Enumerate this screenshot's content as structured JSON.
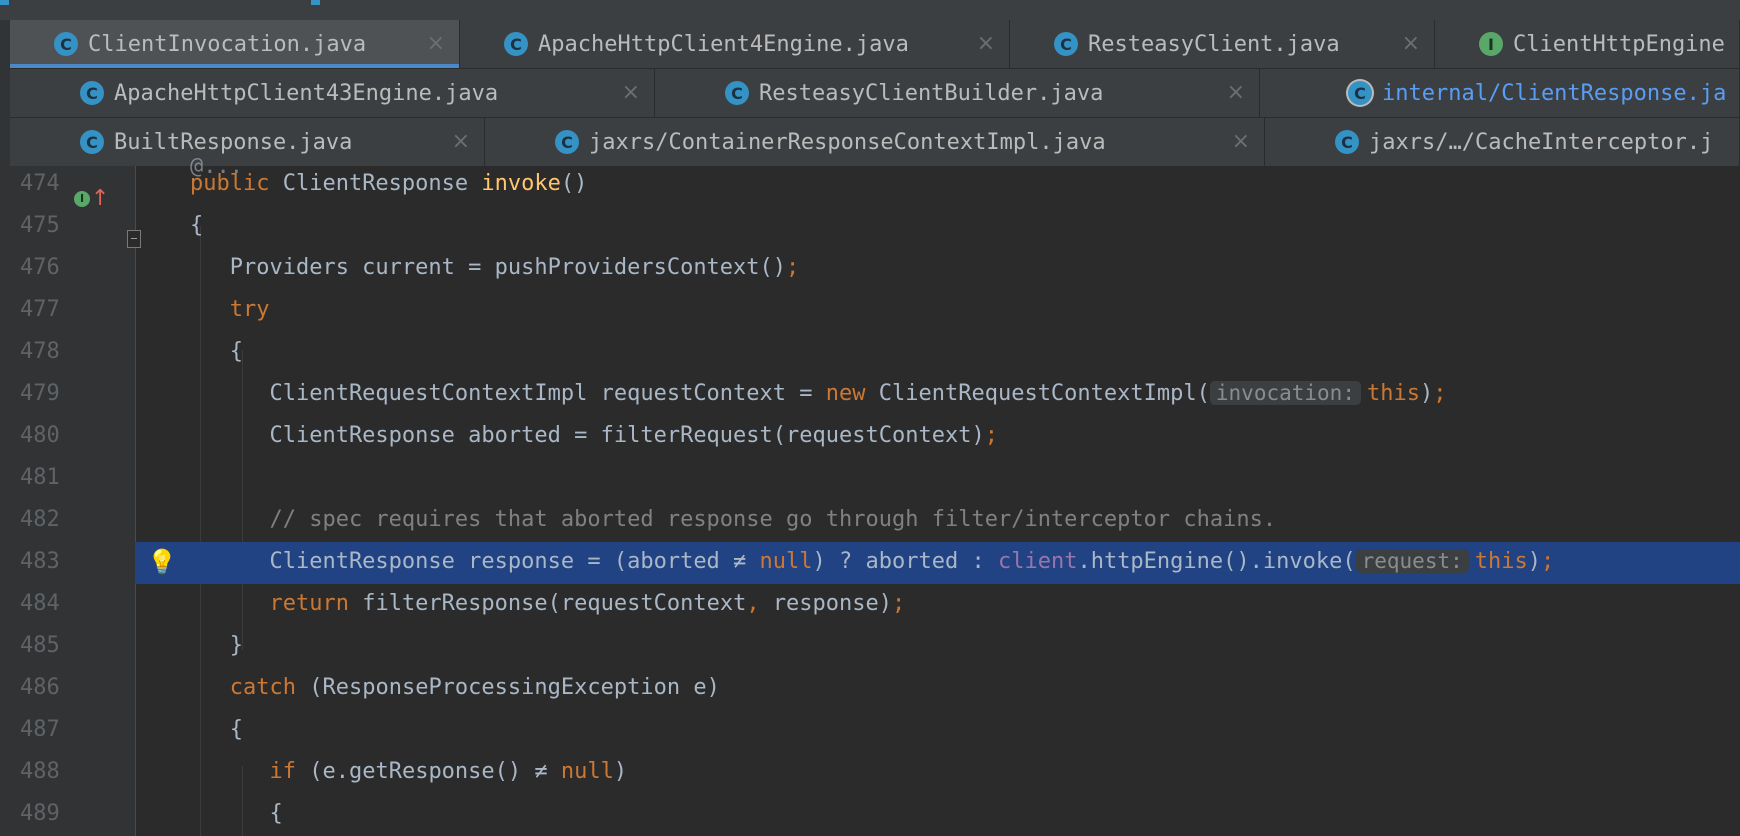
{
  "tab_rows": [
    [
      {
        "label": "ClientInvocation.java",
        "icon": "C",
        "icon_name": "class-icon",
        "active": true,
        "close": "×"
      },
      {
        "label": "ApacheHttpClient4Engine.java",
        "icon": "C",
        "icon_name": "class-icon",
        "close": "×"
      },
      {
        "label": "ResteasyClient.java",
        "icon": "C",
        "icon_name": "class-icon",
        "close": "×"
      },
      {
        "label": "ClientHttpEngine",
        "icon": "I",
        "icon_name": "interface-icon",
        "close": ""
      }
    ],
    [
      {
        "label": "ApacheHttpClient43Engine.java",
        "icon": "C",
        "icon_name": "class-icon",
        "close": "×"
      },
      {
        "label": "ResteasyClientBuilder.java",
        "icon": "C",
        "icon_name": "class-icon",
        "close": "×"
      },
      {
        "label": "internal/ClientResponse.ja",
        "icon": "C",
        "icon_name": "class-icon",
        "close": ""
      }
    ],
    [
      {
        "label": "BuiltResponse.java",
        "icon": "C",
        "icon_name": "class-icon",
        "close": "×"
      },
      {
        "label": "jaxrs/ContainerResponseContextImpl.java",
        "icon": "C",
        "icon_name": "class-icon",
        "close": "×"
      },
      {
        "label": "jaxrs/…/CacheInterceptor.j",
        "icon": "C",
        "icon_name": "class-icon",
        "close": ""
      }
    ]
  ],
  "editor": {
    "top_fragment": "@...",
    "current_line": 483,
    "lines": [
      {
        "no": "474",
        "code": [
          {
            "t": "public ",
            "c": "kw"
          },
          {
            "t": "ClientResponse "
          },
          {
            "t": "invoke",
            "c": "fn"
          },
          {
            "t": "()"
          }
        ]
      },
      {
        "no": "475",
        "code": [
          {
            "t": "{"
          }
        ]
      },
      {
        "no": "476",
        "code": [
          {
            "t": "   Providers current = pushProvidersContext()"
          },
          {
            "t": ";",
            "c": "kw"
          }
        ]
      },
      {
        "no": "477",
        "code": [
          {
            "t": "   "
          },
          {
            "t": "try",
            "c": "kw"
          }
        ]
      },
      {
        "no": "478",
        "code": [
          {
            "t": "   {"
          }
        ]
      },
      {
        "no": "479",
        "code": [
          {
            "t": "      ClientRequestContextImpl requestContext = "
          },
          {
            "t": "new ",
            "c": "kw"
          },
          {
            "t": "ClientRequestContextImpl("
          },
          {
            "t": "invocation:",
            "c": "hint"
          },
          {
            "t": "this",
            "c": "kw"
          },
          {
            "t": ")"
          },
          {
            "t": ";",
            "c": "kw"
          }
        ]
      },
      {
        "no": "480",
        "code": [
          {
            "t": "      ClientResponse aborted = filterRequest(requestContext)"
          },
          {
            "t": ";",
            "c": "kw"
          }
        ]
      },
      {
        "no": "481",
        "code": [
          {
            "t": ""
          }
        ]
      },
      {
        "no": "482",
        "code": [
          {
            "t": "      // spec requires that aborted response go through filter/interceptor chains.",
            "c": "cmt"
          }
        ]
      },
      {
        "no": "483",
        "code": [
          {
            "t": "      ClientResponse response = (aborted ≠ "
          },
          {
            "t": "null",
            "c": "kw"
          },
          {
            "t": ") ? aborted : "
          },
          {
            "t": "client",
            "c": "fld"
          },
          {
            "t": ".httpEngine().invoke("
          },
          {
            "t": "request:",
            "c": "hint"
          },
          {
            "t": "this",
            "c": "kw"
          },
          {
            "t": ")"
          },
          {
            "t": ";",
            "c": "kw"
          }
        ]
      },
      {
        "no": "484",
        "code": [
          {
            "t": "      "
          },
          {
            "t": "return ",
            "c": "kw"
          },
          {
            "t": "filterResponse(requestContext"
          },
          {
            "t": ", ",
            "c": "kw"
          },
          {
            "t": "response)"
          },
          {
            "t": ";",
            "c": "kw"
          }
        ]
      },
      {
        "no": "485",
        "code": [
          {
            "t": "   }"
          }
        ]
      },
      {
        "no": "486",
        "code": [
          {
            "t": "   "
          },
          {
            "t": "catch ",
            "c": "kw"
          },
          {
            "t": "(ResponseProcessingException e)"
          }
        ]
      },
      {
        "no": "487",
        "code": [
          {
            "t": "   {"
          }
        ]
      },
      {
        "no": "488",
        "code": [
          {
            "t": "      "
          },
          {
            "t": "if ",
            "c": "kw"
          },
          {
            "t": "(e.getResponse() ≠ "
          },
          {
            "t": "null",
            "c": "kw"
          },
          {
            "t": ")"
          }
        ]
      },
      {
        "no": "489",
        "code": [
          {
            "t": "      {"
          }
        ]
      }
    ]
  },
  "icons": {
    "implements": "implements-icon",
    "override": "override-up-icon",
    "bulb": "lightbulb-icon",
    "fold": "fold-marker-icon"
  }
}
